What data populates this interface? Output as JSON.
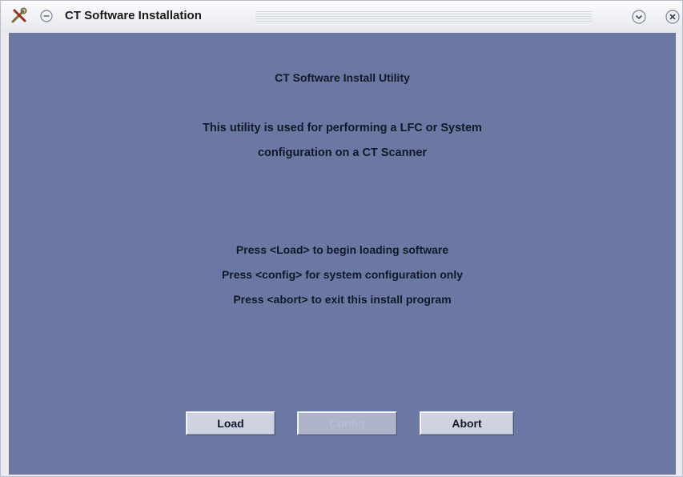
{
  "window": {
    "title": "CT Software Installation"
  },
  "content": {
    "heading": "CT Software Install Utility",
    "description_line1": "This utility is used for performing a LFC or System",
    "description_line2": "configuration on a CT Scanner",
    "instructions": [
      "Press <Load> to begin loading software",
      "Press <config> for system configuration only",
      "Press <abort> to exit this install program"
    ]
  },
  "buttons": {
    "load": "Load",
    "config": "Config",
    "abort": "Abort"
  },
  "icons": {
    "app": "tools-icon",
    "menu": "window-menu-icon",
    "minimize": "minimize-icon",
    "close": "close-icon"
  },
  "colors": {
    "content_background": "#6b78a4",
    "button_face": "#cfd2e0",
    "button_disabled_text": "#b8bccc"
  }
}
